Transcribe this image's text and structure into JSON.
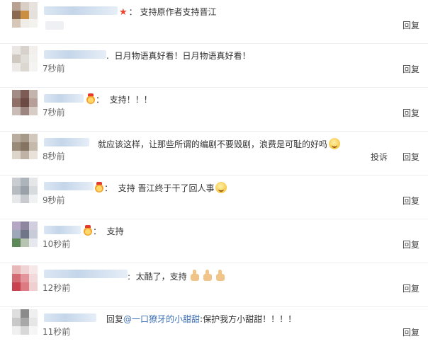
{
  "comments": [
    {
      "text": "支持原作者支持晋江",
      "timestamp": "",
      "actions": [
        "回复"
      ]
    },
    {
      "text": "日月物语真好看！日月物语真好看！",
      "timestamp": "7秒前",
      "actions": [
        "回复"
      ]
    },
    {
      "text": "支持！！！",
      "timestamp": "7秒前",
      "actions": [
        "回复"
      ]
    },
    {
      "text": "就应该这样，让那些所谓的编剧不要毁剧，浪费是可耻的好吗",
      "timestamp": "8秒前",
      "actions": [
        "投诉",
        "回复"
      ]
    },
    {
      "text": "支持 晋江终于干了回人事",
      "timestamp": "9秒前",
      "actions": [
        "回复"
      ]
    },
    {
      "text": "支持",
      "timestamp": "10秒前",
      "actions": [
        "回复"
      ]
    },
    {
      "text": "太酷了，支持",
      "timestamp": "12秒前",
      "actions": [
        "回复"
      ]
    },
    {
      "reply_prefix": "回复",
      "mention": "@一口獠牙的小甜甜",
      "text": ":保护我方小甜甜！！！！",
      "timestamp": "11秒前",
      "actions": [
        "回复"
      ]
    }
  ],
  "icons": {
    "star": "star-icon",
    "crown": "crown-badge-icon",
    "smile": "smile-emoji-icon",
    "grin": "grin-emoji-icon",
    "thumb": "thumbs-up-emoji-icon"
  },
  "colors": {
    "link": "#3a6fb7",
    "star": "#f0422b",
    "divider": "#eceef1"
  }
}
